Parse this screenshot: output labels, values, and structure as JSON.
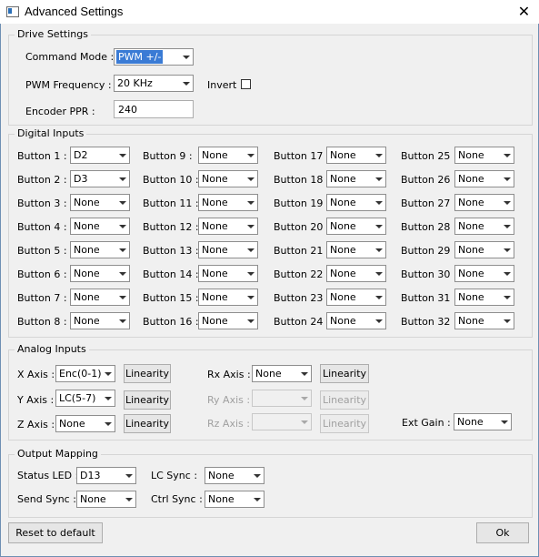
{
  "window": {
    "title": "Advanced Settings"
  },
  "drive": {
    "legend": "Drive Settings",
    "command_mode_label": "Command Mode :",
    "command_mode_value": "PWM +/-",
    "pwm_freq_label": "PWM Frequency :",
    "pwm_freq_value": "20 KHz",
    "invert_label": "Invert",
    "encoder_ppr_label": "Encoder PPR :",
    "encoder_ppr_value": "240"
  },
  "digital": {
    "legend": "Digital Inputs",
    "buttons": [
      {
        "label": "Button  1 :",
        "value": "D2"
      },
      {
        "label": "Button  2 :",
        "value": "D3"
      },
      {
        "label": "Button  3 :",
        "value": "None"
      },
      {
        "label": "Button  4 :",
        "value": "None"
      },
      {
        "label": "Button  5 :",
        "value": "None"
      },
      {
        "label": "Button  6 :",
        "value": "None"
      },
      {
        "label": "Button  7 :",
        "value": "None"
      },
      {
        "label": "Button  8 :",
        "value": "None"
      },
      {
        "label": "Button  9 :",
        "value": "None"
      },
      {
        "label": "Button 10 :",
        "value": "None"
      },
      {
        "label": "Button 11 :",
        "value": "None"
      },
      {
        "label": "Button 12 :",
        "value": "None"
      },
      {
        "label": "Button 13 :",
        "value": "None"
      },
      {
        "label": "Button 14 :",
        "value": "None"
      },
      {
        "label": "Button 15 :",
        "value": "None"
      },
      {
        "label": "Button 16 :",
        "value": "None"
      },
      {
        "label": "Button 17 :",
        "value": "None"
      },
      {
        "label": "Button 18 :",
        "value": "None"
      },
      {
        "label": "Button 19 :",
        "value": "None"
      },
      {
        "label": "Button 20 :",
        "value": "None"
      },
      {
        "label": "Button 21 :",
        "value": "None"
      },
      {
        "label": "Button 22 :",
        "value": "None"
      },
      {
        "label": "Button 23 :",
        "value": "None"
      },
      {
        "label": "Button 24 :",
        "value": "None"
      },
      {
        "label": "Button 25 :",
        "value": "None"
      },
      {
        "label": "Button 26 :",
        "value": "None"
      },
      {
        "label": "Button 27 :",
        "value": "None"
      },
      {
        "label": "Button 28 :",
        "value": "None"
      },
      {
        "label": "Button 29 :",
        "value": "None"
      },
      {
        "label": "Button 30 :",
        "value": "None"
      },
      {
        "label": "Button 31 :",
        "value": "None"
      },
      {
        "label": "Button 32 :",
        "value": "None"
      }
    ]
  },
  "analog": {
    "legend": "Analog Inputs",
    "x_label": "X Axis :",
    "x_value": "Enc(0-1)",
    "y_label": "Y Axis :",
    "y_value": "LC(5-7)",
    "z_label": "Z Axis :",
    "z_value": "None",
    "rx_label": "Rx Axis :",
    "rx_value": "None",
    "ry_label": "Ry Axis :",
    "ry_value": "",
    "rz_label": "Rz Axis :",
    "rz_value": "",
    "linearity_label": "Linearity",
    "ext_gain_label": "Ext Gain :",
    "ext_gain_value": "None"
  },
  "output": {
    "legend": "Output Mapping",
    "status_led_label": "Status LED :",
    "status_led_value": "D13",
    "lc_sync_label": "LC Sync :",
    "lc_sync_value": "None",
    "send_sync_label": "Send Sync :",
    "send_sync_value": "None",
    "ctrl_sync_label": "Ctrl Sync :",
    "ctrl_sync_value": "None"
  },
  "footer": {
    "reset_label": "Reset to default",
    "ok_label": "Ok"
  }
}
